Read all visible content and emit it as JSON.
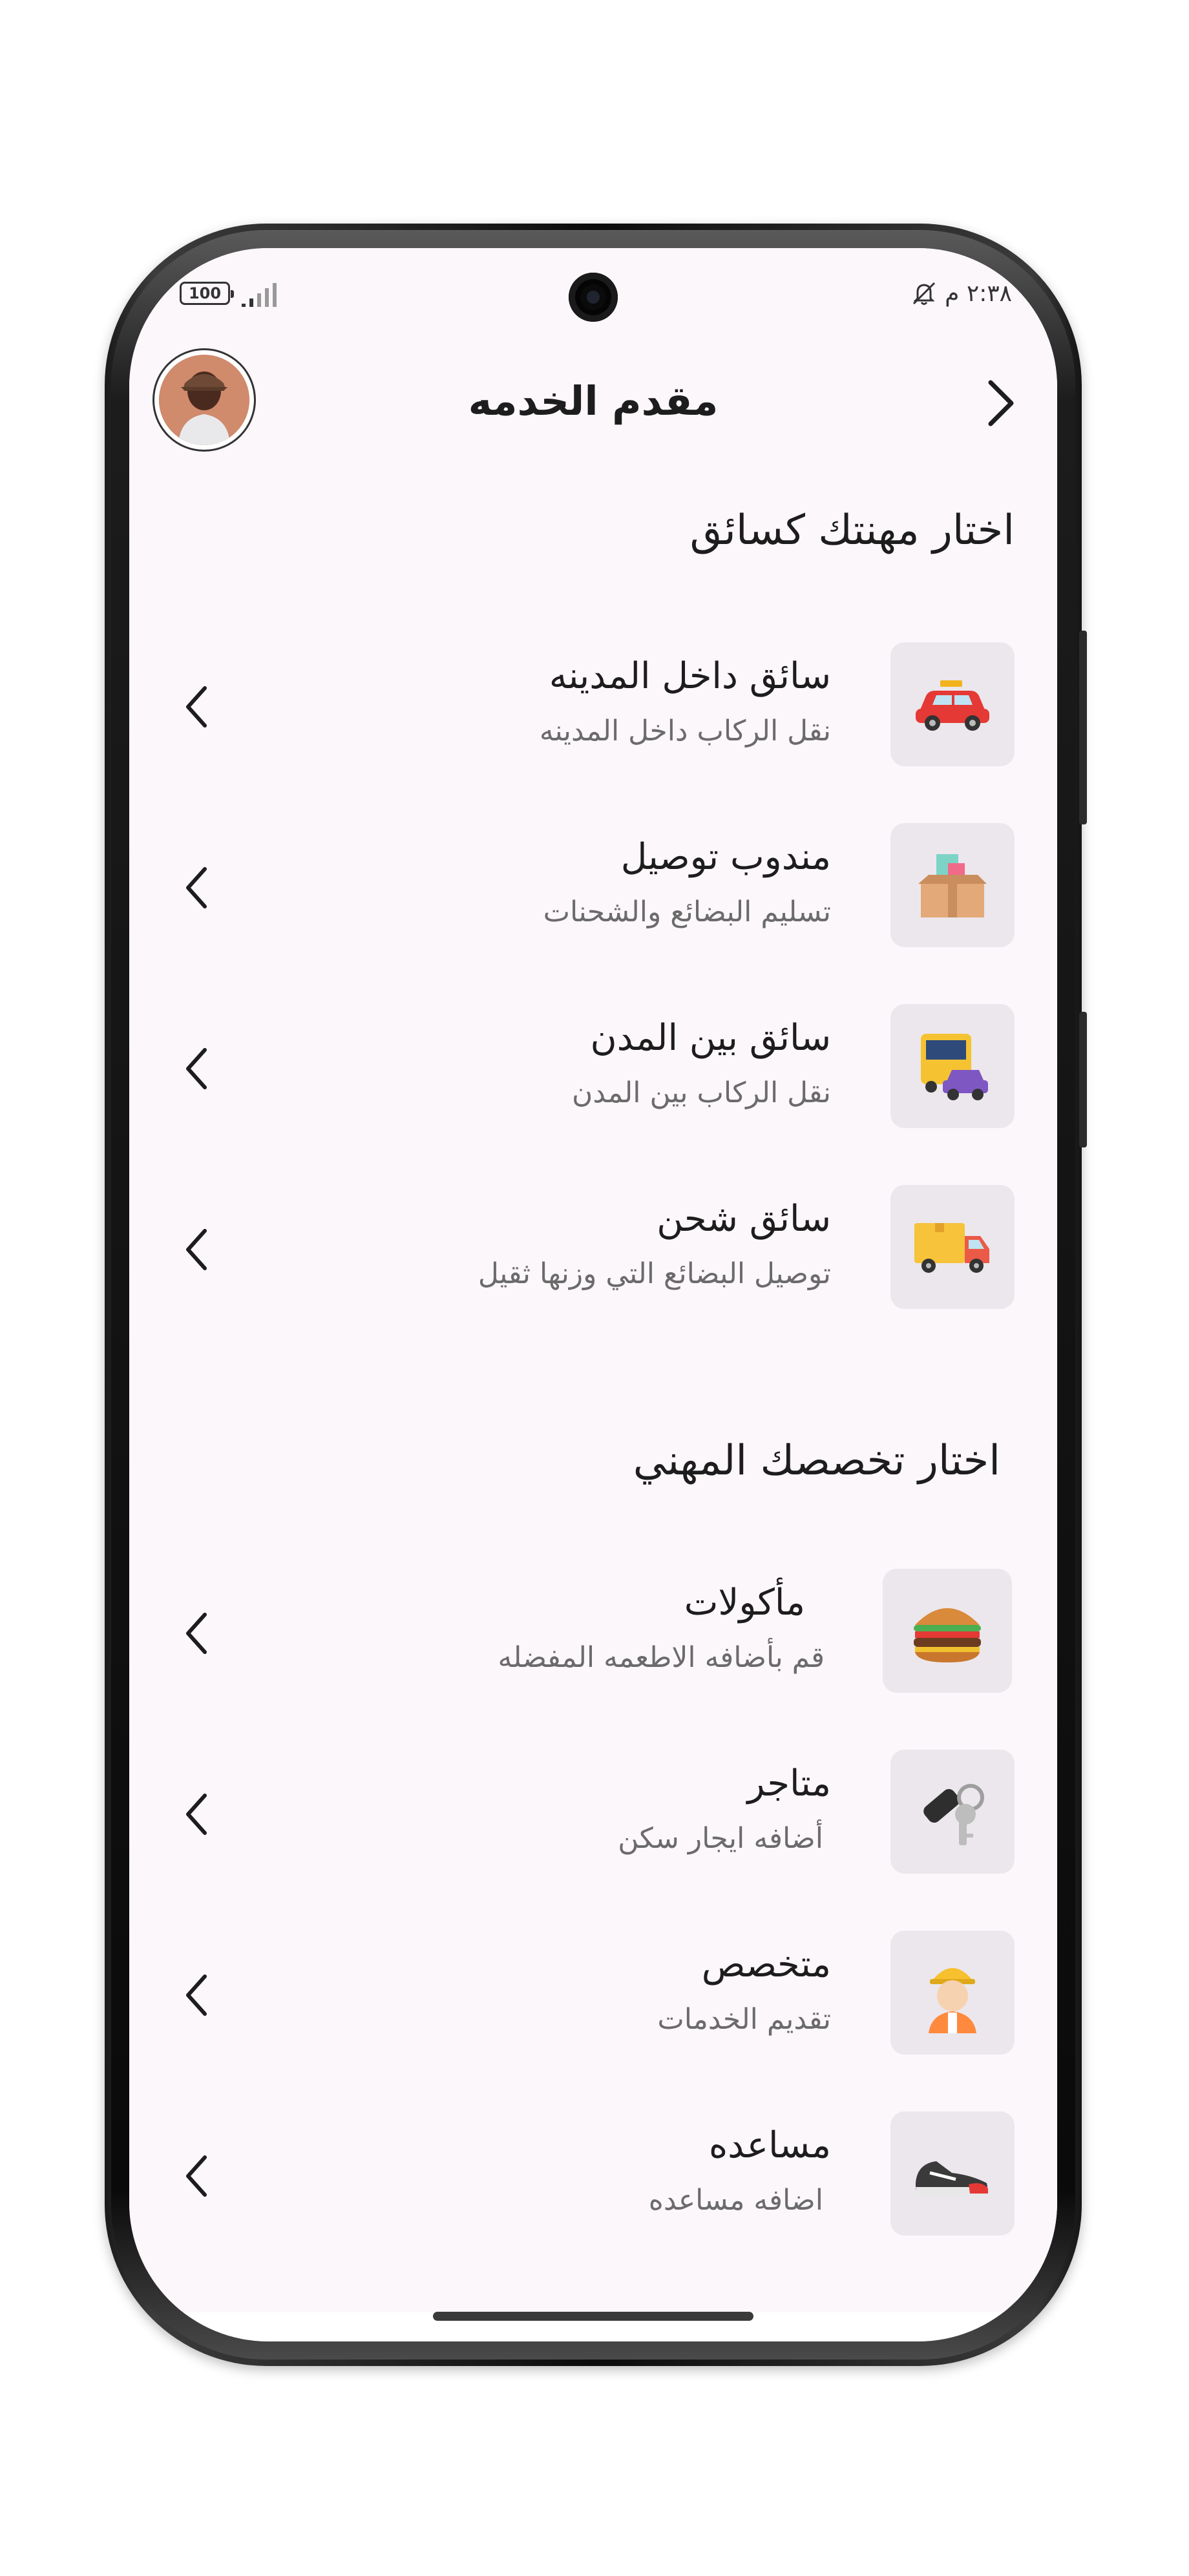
{
  "status_bar": {
    "time": "٢:٣٨ م",
    "battery_level": "100",
    "icons": [
      "mute-icon",
      "signal-icon",
      "battery-icon",
      "camera-cutout"
    ]
  },
  "header": {
    "title": "مقدم الخدمه",
    "back_icon": "chevron-right-icon",
    "avatar": "user-avatar"
  },
  "section_driver": {
    "title": "اختار مهنتك كسائق",
    "items": [
      {
        "title": "سائق داخل المدينه",
        "subtitle": "نقل الركاب داخل المدينه",
        "icon": "car-icon"
      },
      {
        "title": "مندوب توصيل",
        "subtitle": "تسليم البضائع والشحنات",
        "icon": "delivery-box-icon"
      },
      {
        "title": "سائق  بين المدن",
        "subtitle": "نقل الركاب بين المدن",
        "icon": "bus-car-icon"
      },
      {
        "title": "سائق  شحن",
        "subtitle": "توصيل البضائع التي وزنها ثقيل",
        "icon": "truck-icon"
      }
    ]
  },
  "section_specialty": {
    "title": "اختار تخصصك المهني",
    "items": [
      {
        "title": "مأكولات",
        "subtitle": "قم بأضافه الاطعمه المفضله",
        "icon": "burger-icon"
      },
      {
        "title": "متاجر",
        "subtitle": "أضافه ايجار سكن",
        "icon": "car-key-icon"
      },
      {
        "title": "متخصص",
        "subtitle": "تقديم الخدمات",
        "icon": "worker-icon"
      },
      {
        "title": "مساعده",
        "subtitle": "اضافه مساعده",
        "icon": "sneaker-icon"
      }
    ]
  },
  "colors": {
    "background": "#fcf7fb",
    "icon_box": "#ece7ec",
    "text_primary": "#1d1d1d",
    "text_secondary": "#6b6b6b"
  }
}
